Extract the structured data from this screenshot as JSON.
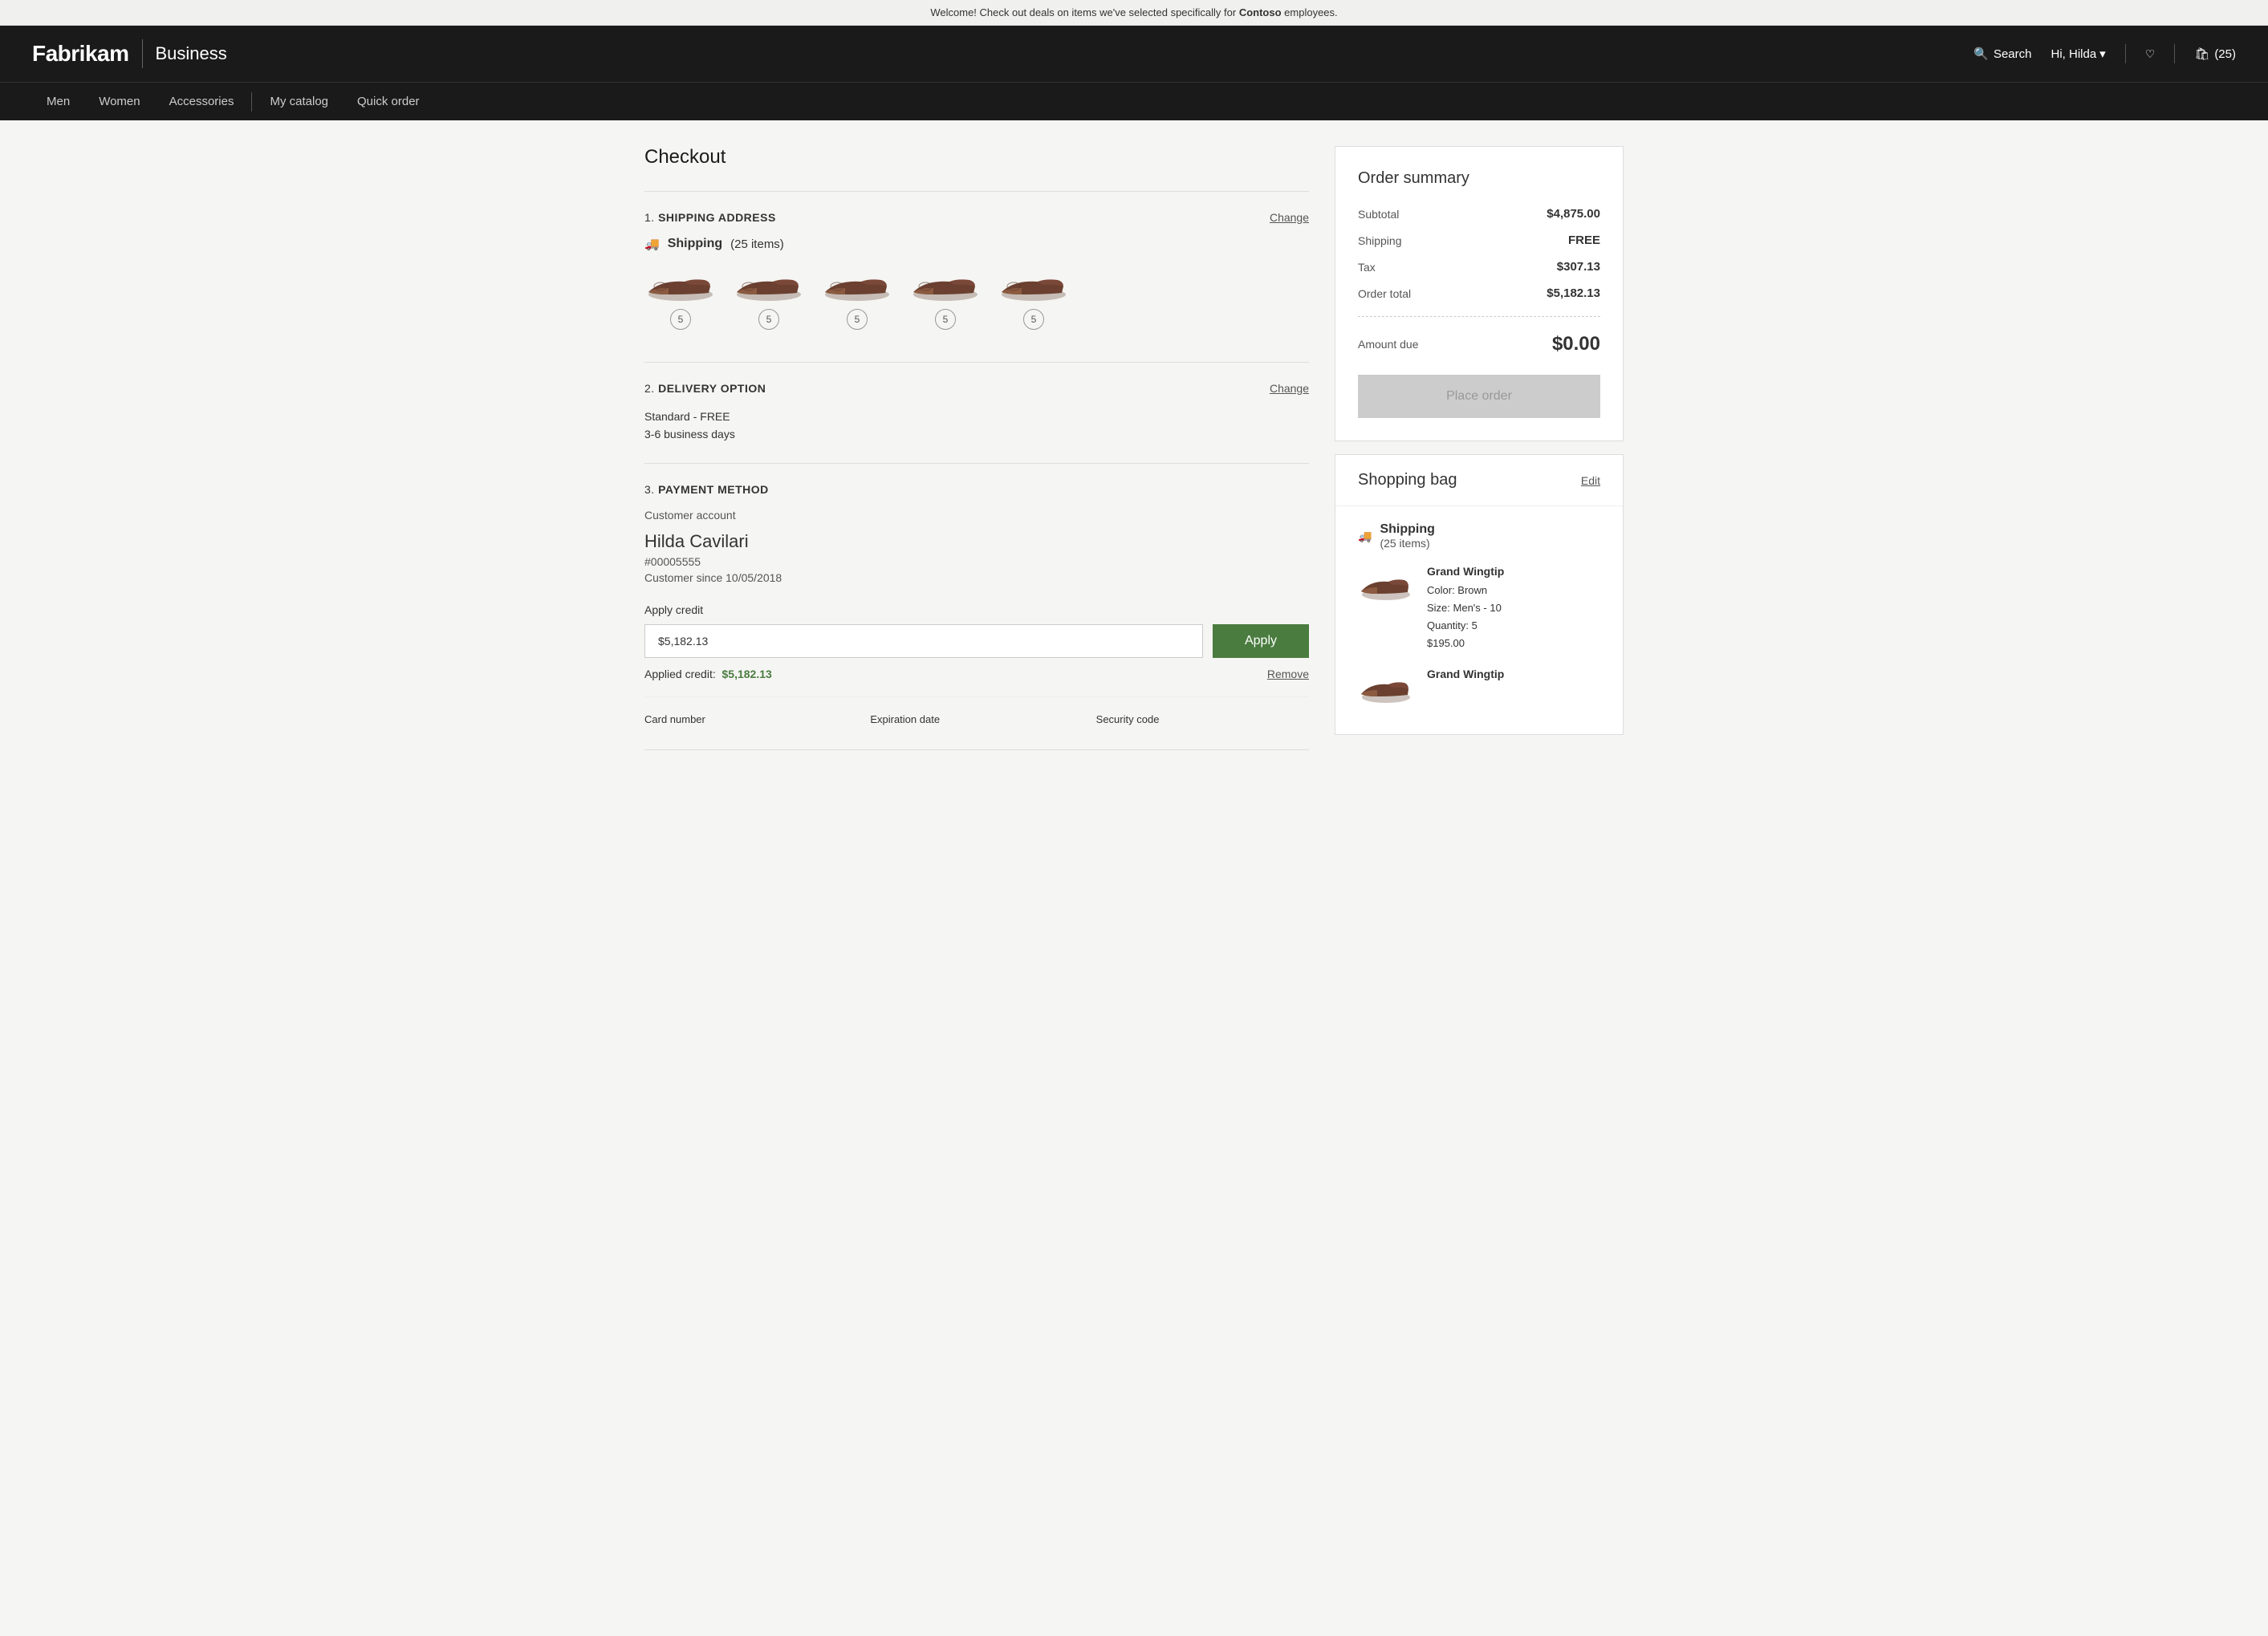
{
  "announcement": {
    "text_before": "Welcome! Check out deals on items we've selected specifically for ",
    "brand": "Contoso",
    "text_after": " employees."
  },
  "header": {
    "logo": "Fabrikam",
    "divider": "|",
    "business": "Business",
    "search_label": "Search",
    "user_label": "Hi, Hilda",
    "cart_count": "(25)"
  },
  "nav": {
    "items": [
      {
        "label": "Men"
      },
      {
        "label": "Women"
      },
      {
        "label": "Accessories"
      },
      {
        "label": "My catalog"
      },
      {
        "label": "Quick order"
      }
    ]
  },
  "page": {
    "title": "Checkout"
  },
  "sections": {
    "shipping": {
      "number": "1.",
      "title": "SHIPPING ADDRESS",
      "change_label": "Change",
      "shipping_label": "Shipping",
      "items_count": "(25 items)",
      "shoe_qty": [
        "5",
        "5",
        "5",
        "5",
        "5"
      ]
    },
    "delivery": {
      "number": "2.",
      "title": "DELIVERY OPTION",
      "change_label": "Change",
      "option": "Standard - FREE",
      "days": "3-6 business days"
    },
    "payment": {
      "number": "3.",
      "title": "PAYMENT METHOD",
      "account_label": "Customer account",
      "customer_name": "Hilda Cavilari",
      "customer_id": "#00005555",
      "customer_since": "Customer since 10/05/2018",
      "apply_credit_label": "Apply credit",
      "credit_value": "$5,182.13",
      "apply_btn_label": "Apply",
      "applied_label": "Applied credit:",
      "applied_amount": "$5,182.13",
      "remove_label": "Remove",
      "card_number_label": "Card number",
      "expiration_label": "Expiration date",
      "security_label": "Security code"
    }
  },
  "order_summary": {
    "title": "Order summary",
    "subtotal_label": "Subtotal",
    "subtotal_value": "$4,875.00",
    "shipping_label": "Shipping",
    "shipping_value": "FREE",
    "tax_label": "Tax",
    "tax_value": "$307.13",
    "order_total_label": "Order total",
    "order_total_value": "$5,182.13",
    "amount_due_label": "Amount due",
    "amount_due_value": "$0.00",
    "place_order_label": "Place order"
  },
  "shopping_bag": {
    "title": "Shopping bag",
    "edit_label": "Edit",
    "shipping_title": "Shipping",
    "shipping_subtitle": "(25 items)",
    "items": [
      {
        "name": "Grand Wingtip",
        "color": "Color: Brown",
        "size": "Size: Men's - 10",
        "quantity": "Quantity: 5",
        "price": "$195.00"
      },
      {
        "name": "Grand Wingtip",
        "color": "",
        "size": "",
        "quantity": "",
        "price": ""
      }
    ]
  },
  "colors": {
    "header_bg": "#1a1a1a",
    "apply_btn": "#4a7c3f",
    "credit_green": "#4a7c3f",
    "place_order_bg": "#cccccc"
  }
}
